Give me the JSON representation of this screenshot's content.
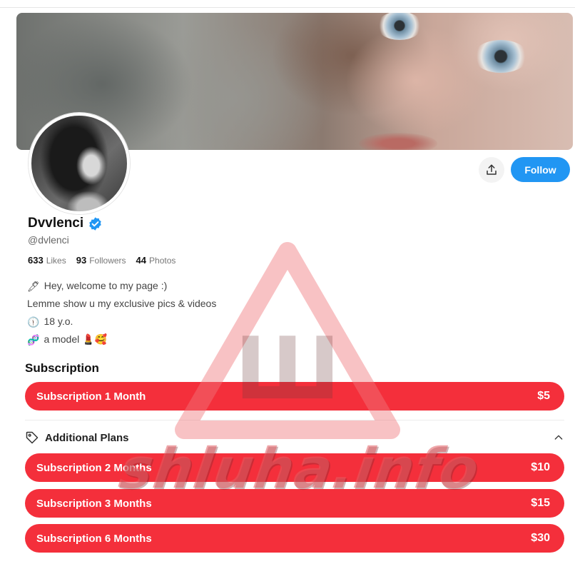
{
  "profile": {
    "name": "Dvvlenci",
    "handle": "@dvlenci",
    "verified": true,
    "stats": [
      {
        "value": "633",
        "label": "Likes"
      },
      {
        "value": "93",
        "label": "Followers"
      },
      {
        "value": "44",
        "label": "Photos"
      }
    ],
    "bio": [
      {
        "icon": "pen-icon",
        "glyph": "🖊",
        "text": "Hey, welcome to my page :)"
      },
      {
        "icon": "",
        "glyph": "",
        "text": "Lemme show u my exclusive pics & videos"
      },
      {
        "icon": "clock-icon",
        "glyph": "🕦",
        "text": "18 y.o."
      },
      {
        "icon": "dna-icon",
        "glyph": "🧬",
        "text": "a model 💄🥰"
      }
    ]
  },
  "actions": {
    "follow_label": "Follow"
  },
  "subscription": {
    "title": "Subscription",
    "main_plan": {
      "label": "Subscription 1 Month",
      "price": "$5"
    },
    "additional_title": "Additional Plans",
    "additional_plans": [
      {
        "label": "Subscription 2 Months",
        "price": "$10"
      },
      {
        "label": "Subscription 3 Months",
        "price": "$15"
      },
      {
        "label": "Subscription 6 Months",
        "price": "$30"
      }
    ]
  },
  "watermark": {
    "text": "shluha.info",
    "letter": "Ш"
  },
  "colors": {
    "accent": "#2196f3",
    "plan": "#f42f3b"
  }
}
